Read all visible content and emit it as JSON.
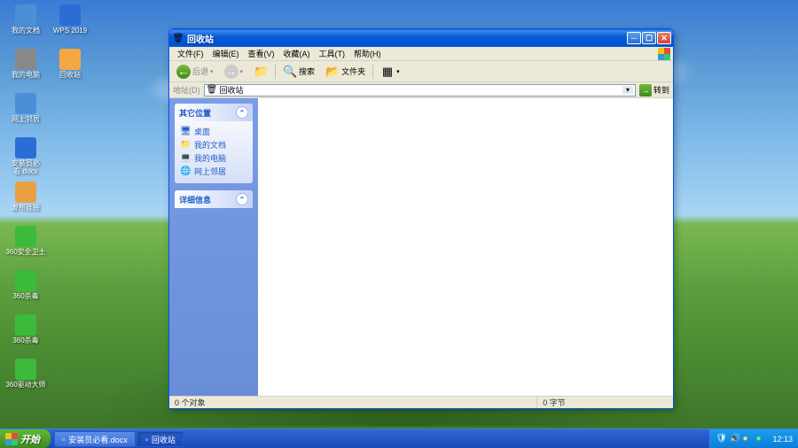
{
  "desktop_icons": [
    {
      "label": "我的文档",
      "color": "#4a90d9"
    },
    {
      "label": "我的电脑",
      "color": "#888"
    },
    {
      "label": "网上邻居",
      "color": "#4a90d9"
    },
    {
      "label": "安装员必看.docx",
      "color": "#2a6ed5"
    },
    {
      "label": "发布连接",
      "color": "#e8a042"
    },
    {
      "label": "360安全卫士",
      "color": "#3cba3c"
    },
    {
      "label": "360杀毒",
      "color": "#3cba3c"
    },
    {
      "label": "360杀毒",
      "color": "#3cba3c"
    },
    {
      "label": "360驱动大师",
      "color": "#3cba3c"
    },
    {
      "label": "WPS 2019",
      "color": "#2a6ed5"
    },
    {
      "label": "回收站",
      "color": "#f4a742"
    }
  ],
  "window": {
    "title": "回收站",
    "menu": [
      "文件(F)",
      "编辑(E)",
      "查看(V)",
      "收藏(A)",
      "工具(T)",
      "帮助(H)"
    ],
    "toolbar": {
      "back": "后退",
      "search": "搜索",
      "folders": "文件夹"
    },
    "addressbar": {
      "label": "地址(D)",
      "value": "回收站",
      "go": "转到"
    },
    "sidebar": {
      "section1_title": "其它位置",
      "links": [
        {
          "icon": "🖥",
          "label": "桌面"
        },
        {
          "icon": "📁",
          "label": "我的文档"
        },
        {
          "icon": "💻",
          "label": "我的电脑"
        },
        {
          "icon": "🌐",
          "label": "网上邻居"
        }
      ],
      "section2_title": "详细信息"
    },
    "statusbar": {
      "objects": "0 个对象",
      "bytes": "0 字节"
    }
  },
  "taskbar": {
    "start": "开始",
    "items": [
      {
        "label": "安装员必看.docx",
        "active": false
      },
      {
        "label": "回收站",
        "active": true
      }
    ],
    "clock": "12:13"
  }
}
